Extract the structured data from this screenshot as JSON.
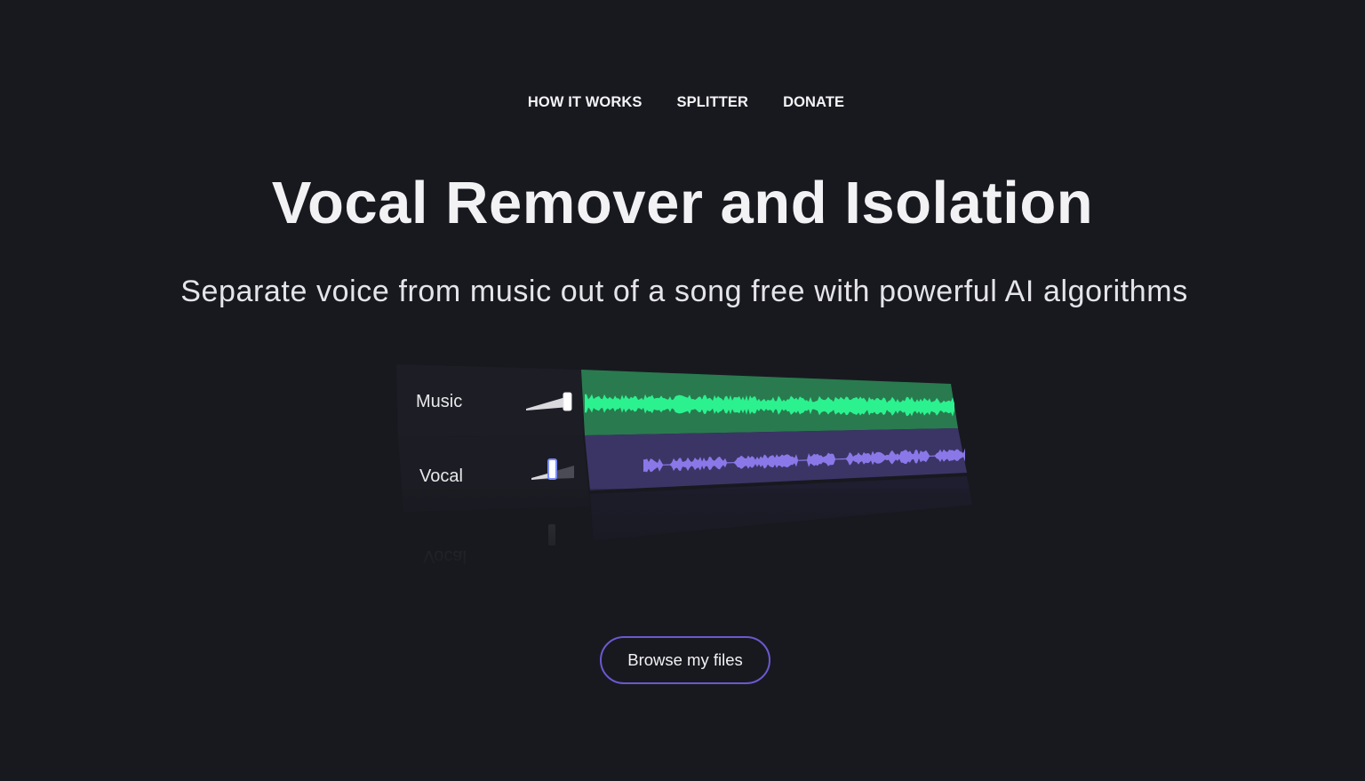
{
  "nav": {
    "items": [
      {
        "label": "HOW IT WORKS"
      },
      {
        "label": "SPLITTER"
      },
      {
        "label": "DONATE"
      }
    ]
  },
  "hero": {
    "title": "Vocal Remover and Isolation",
    "subtitle": "Separate voice from music out of a song free with powerful AI algorithms"
  },
  "mixer": {
    "tracks": [
      {
        "label": "Music",
        "waveform_color": "#2bf28f",
        "lane_color": "#2a7a4f",
        "volume": 1.0
      },
      {
        "label": "Vocal",
        "waveform_color": "#8a78e8",
        "lane_color": "#3b3566",
        "volume": 0.45
      }
    ]
  },
  "cta": {
    "browse_label": "Browse my files",
    "border_color": "#6b58d0"
  },
  "colors": {
    "background": "#18191f",
    "text": "#f2f2f4"
  }
}
